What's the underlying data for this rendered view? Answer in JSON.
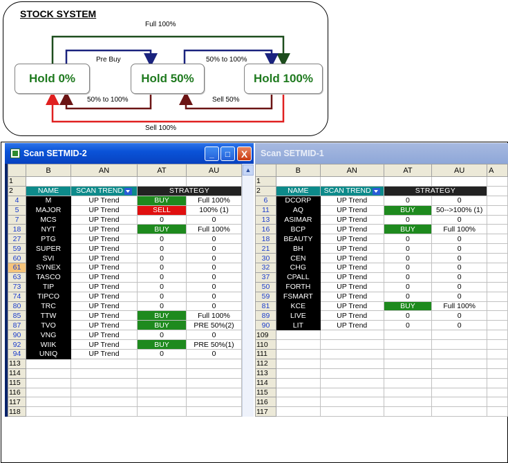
{
  "diagram": {
    "title": "STOCK SYSTEM",
    "states": [
      "Hold 0%",
      "Hold 50%",
      "Hold 100%"
    ],
    "labels": {
      "top_full": "Full 100%",
      "pre_buy": "Pre Buy",
      "up_50_100": "50% to 100%",
      "down_50_100": "50% to 100%",
      "sell_50": "Sell 50%",
      "sell_100": "Sell 100%"
    },
    "colors": {
      "full": "#1d4d1d",
      "buy": "#1a237e",
      "sell50": "#6b1414",
      "sell100": "#e02020",
      "state_text": "#1f7a1f"
    }
  },
  "left_window": {
    "title": "Scan SETMID-2",
    "buttons": {
      "minimize": "_",
      "maximize": "□",
      "close": "X"
    },
    "columns": [
      "B",
      "AN",
      "AT",
      "AU"
    ],
    "header": {
      "name": "NAME",
      "scan": "SCAN TREND",
      "strategy": "STRATEGY"
    },
    "rows": [
      {
        "row": "4",
        "name": "M",
        "trend": "UP Trend",
        "signal": "BUY",
        "strategy": "Full 100%"
      },
      {
        "row": "5",
        "name": "MAJOR",
        "trend": "UP Trend",
        "signal": "SELL",
        "strategy": "100% (1)"
      },
      {
        "row": "7",
        "name": "MCS",
        "trend": "UP Trend",
        "signal": "0",
        "strategy": "0"
      },
      {
        "row": "18",
        "name": "NYT",
        "trend": "UP Trend",
        "signal": "BUY",
        "strategy": "Full 100%"
      },
      {
        "row": "27",
        "name": "PTG",
        "trend": "UP Trend",
        "signal": "0",
        "strategy": "0"
      },
      {
        "row": "59",
        "name": "SUPER",
        "trend": "UP Trend",
        "signal": "0",
        "strategy": "0"
      },
      {
        "row": "60",
        "name": "SVI",
        "trend": "UP Trend",
        "signal": "0",
        "strategy": "0"
      },
      {
        "row": "61",
        "name": "SYNEX",
        "trend": "UP Trend",
        "signal": "0",
        "strategy": "0"
      },
      {
        "row": "63",
        "name": "TASCO",
        "trend": "UP Trend",
        "signal": "0",
        "strategy": "0"
      },
      {
        "row": "73",
        "name": "TIP",
        "trend": "UP Trend",
        "signal": "0",
        "strategy": "0"
      },
      {
        "row": "74",
        "name": "TIPCO",
        "trend": "UP Trend",
        "signal": "0",
        "strategy": "0"
      },
      {
        "row": "80",
        "name": "TRC",
        "trend": "UP Trend",
        "signal": "0",
        "strategy": "0"
      },
      {
        "row": "85",
        "name": "TTW",
        "trend": "UP Trend",
        "signal": "BUY",
        "strategy": "Full 100%"
      },
      {
        "row": "87",
        "name": "TVO",
        "trend": "UP Trend",
        "signal": "BUY",
        "strategy": "PRE 50%(2)"
      },
      {
        "row": "90",
        "name": "VNG",
        "trend": "UP Trend",
        "signal": "0",
        "strategy": "0"
      },
      {
        "row": "92",
        "name": "WIIK",
        "trend": "UP Trend",
        "signal": "BUY",
        "strategy": "PRE 50%(1)"
      },
      {
        "row": "94",
        "name": "UNIQ",
        "trend": "UP Trend",
        "signal": "0",
        "strategy": "0"
      }
    ],
    "empty_rows": [
      "113",
      "114",
      "115",
      "116",
      "117",
      "118"
    ]
  },
  "right_window": {
    "title": "Scan SETMID-1",
    "columns": [
      "B",
      "AN",
      "AT",
      "AU",
      "A"
    ],
    "header": {
      "name": "NAME",
      "scan": "SCAN TREND",
      "strategy": "STRATEGY"
    },
    "rows": [
      {
        "row": "6",
        "name": "DCORP",
        "trend": "UP Trend",
        "signal": "0",
        "strategy": "0"
      },
      {
        "row": "11",
        "name": "AQ",
        "trend": "UP Trend",
        "signal": "BUY",
        "strategy": "50-->100% (1)"
      },
      {
        "row": "13",
        "name": "ASIMAR",
        "trend": "UP Trend",
        "signal": "0",
        "strategy": "0"
      },
      {
        "row": "16",
        "name": "BCP",
        "trend": "UP Trend",
        "signal": "BUY",
        "strategy": "Full 100%"
      },
      {
        "row": "18",
        "name": "BEAUTY",
        "trend": "UP Trend",
        "signal": "0",
        "strategy": "0"
      },
      {
        "row": "21",
        "name": "BH",
        "trend": "UP Trend",
        "signal": "0",
        "strategy": "0"
      },
      {
        "row": "30",
        "name": "CEN",
        "trend": "UP Trend",
        "signal": "0",
        "strategy": "0"
      },
      {
        "row": "32",
        "name": "CHG",
        "trend": "UP Trend",
        "signal": "0",
        "strategy": "0"
      },
      {
        "row": "37",
        "name": "CPALL",
        "trend": "UP Trend",
        "signal": "0",
        "strategy": "0"
      },
      {
        "row": "50",
        "name": "FORTH",
        "trend": "UP Trend",
        "signal": "0",
        "strategy": "0"
      },
      {
        "row": "59",
        "name": "FSMART",
        "trend": "UP Trend",
        "signal": "0",
        "strategy": "0"
      },
      {
        "row": "81",
        "name": "KCE",
        "trend": "UP Trend",
        "signal": "BUY",
        "strategy": "Full 100%"
      },
      {
        "row": "89",
        "name": "LIVE",
        "trend": "UP Trend",
        "signal": "0",
        "strategy": "0"
      },
      {
        "row": "90",
        "name": "LIT",
        "trend": "UP Trend",
        "signal": "0",
        "strategy": "0"
      }
    ],
    "empty_rows": [
      "109",
      "110",
      "111",
      "112",
      "113",
      "114",
      "115",
      "116",
      "117"
    ]
  }
}
